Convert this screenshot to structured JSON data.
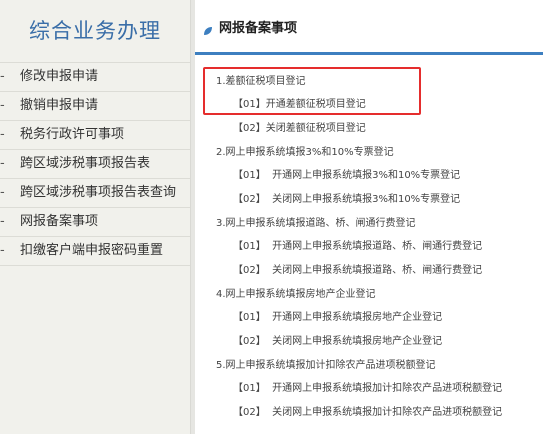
{
  "sidebar": {
    "title": "综合业务办理",
    "items": [
      {
        "label": "修改申报申请"
      },
      {
        "label": "撤销申报申请"
      },
      {
        "label": "税务行政许可事项"
      },
      {
        "label": "跨区域涉税事项报告表"
      },
      {
        "label": "跨区域涉税事项报告表查询"
      },
      {
        "label": "网报备案事项"
      },
      {
        "label": "扣缴客户端申报密码重置"
      }
    ]
  },
  "main": {
    "title": "网报备案事项",
    "sections": [
      {
        "label": "1.差额征税项目登记",
        "items": [
          {
            "code": "【01】",
            "label": "开通差额征税项目登记"
          },
          {
            "code": "【02】",
            "label": "关闭差额征税项目登记"
          }
        ]
      },
      {
        "label": "2.网上申报系统填报3%和10%专票登记",
        "items": [
          {
            "code": "【01】",
            "label": "开通网上申报系统填报3%和10%专票登记"
          },
          {
            "code": "【02】",
            "label": "关闭网上申报系统填报3%和10%专票登记"
          }
        ]
      },
      {
        "label": "3.网上申报系统填报道路、桥、闸通行费登记",
        "items": [
          {
            "code": "【01】",
            "label": "开通网上申报系统填报道路、桥、闸通行费登记"
          },
          {
            "code": "【02】",
            "label": "关闭网上申报系统填报道路、桥、闸通行费登记"
          }
        ]
      },
      {
        "label": "4.网上申报系统填报房地产企业登记",
        "items": [
          {
            "code": "【01】",
            "label": "开通网上申报系统填报房地产企业登记"
          },
          {
            "code": "【02】",
            "label": "关闭网上申报系统填报房地产企业登记"
          }
        ]
      },
      {
        "label": "5.网上申报系统填报加计扣除农产品进项税额登记",
        "items": [
          {
            "code": "【01】",
            "label": "开通网上申报系统填报加计扣除农产品进项税额登记"
          },
          {
            "code": "【02】",
            "label": "关闭网上申报系统填报加计扣除农产品进项税额登记"
          }
        ]
      }
    ]
  },
  "colors": {
    "accent": "#3d7fc0",
    "highlight": "#e52d2d",
    "sidebar_title": "#3a6ea8",
    "sidebar_bg": "#f1f1ec"
  },
  "icons": {
    "header_icon": "leaf-icon",
    "sidebar_bullet": "dash-bullet"
  }
}
